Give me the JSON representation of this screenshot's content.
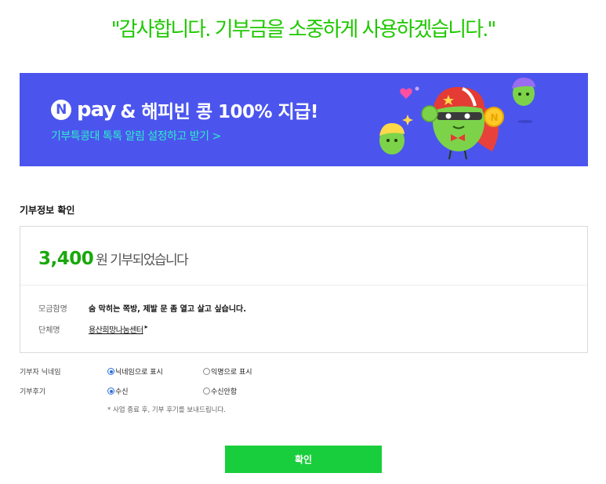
{
  "headline": "\"감사합니다. 기부금을 소중하게 사용하겠습니다.\"",
  "banner": {
    "npay_letter": "N",
    "npay_word": "pay",
    "promo_text": "& 해피빈 콩 100% 지급!",
    "sub_link": "기부특콩대 톡톡 알림 설정하고 받기 >",
    "bg_color": "#4b55ee",
    "accent_color": "#2ef0c8"
  },
  "section": {
    "title": "기부정보 확인"
  },
  "donation": {
    "amount": "3,400",
    "amount_suffix": "원 기부되었습니다",
    "rows": [
      {
        "label": "모금함명",
        "value": "숨 막히는 쪽방, 제발 문 좀 열고 살고 싶습니다."
      },
      {
        "label": "단체명",
        "value": "용산희망나눔센터",
        "arrow": "▸"
      }
    ]
  },
  "options": {
    "nickname": {
      "label": "기부자 닉네임",
      "choices": [
        {
          "label": "닉네임으로 표시",
          "selected": true
        },
        {
          "label": "익명으로 표시",
          "selected": false
        }
      ]
    },
    "review": {
      "label": "기부후기",
      "choices": [
        {
          "label": "수신",
          "selected": true
        },
        {
          "label": "수신안함",
          "selected": false
        }
      ]
    },
    "note": "* 사업 종료 후, 기부 후기를 보내드립니다."
  },
  "confirm_label": "확인",
  "colors": {
    "green": "#1ec800",
    "button": "#19ce3c",
    "amount": "#19a80b"
  }
}
